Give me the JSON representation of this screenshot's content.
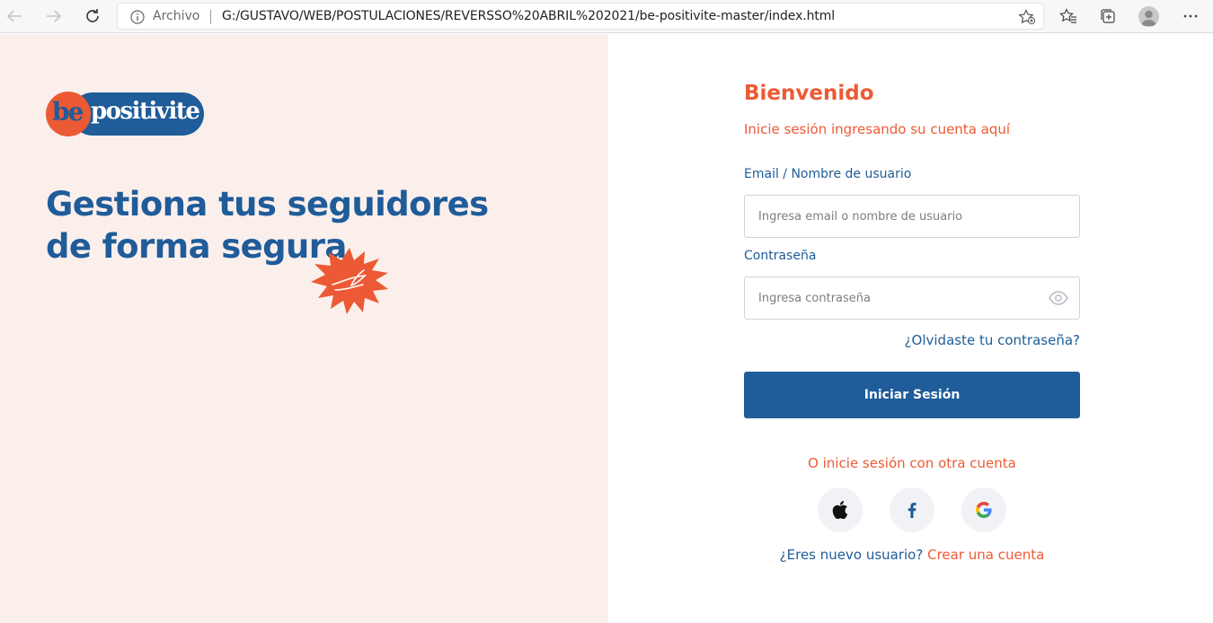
{
  "browser": {
    "address_prefix": "Archivo",
    "url": "G:/GUSTAVO/WEB/POSTULACIONES/REVERSSO%20ABRIL%202021/be-positivite-master/index.html"
  },
  "brand": {
    "logo_be": "be",
    "logo_positivite": "positivite",
    "colors": {
      "primary": "#1f5c99",
      "accent": "#ec5a35",
      "left_bg": "#fbefec"
    }
  },
  "hero": {
    "line1": "Gestiona tus seguidores",
    "line2": "de forma segura"
  },
  "login": {
    "title": "Bienvenido",
    "subtitle": "Inicie sesión ingresando su cuenta aquí",
    "email_label": "Email / Nombre de usuario",
    "email_placeholder": "Ingresa email o nombre de usuario",
    "password_label": "Contraseña",
    "password_placeholder": "Ingresa contraseña",
    "forgot_link": "¿Olvidaste tu contraseña?",
    "submit_label": "Iniciar Sesión",
    "alt_text": "O inicie sesión con otra cuenta",
    "social": [
      "apple-icon",
      "facebook-icon",
      "google-icon"
    ],
    "signup_question": "¿Eres nuevo usuario?",
    "signup_link": "Crear una cuenta"
  }
}
